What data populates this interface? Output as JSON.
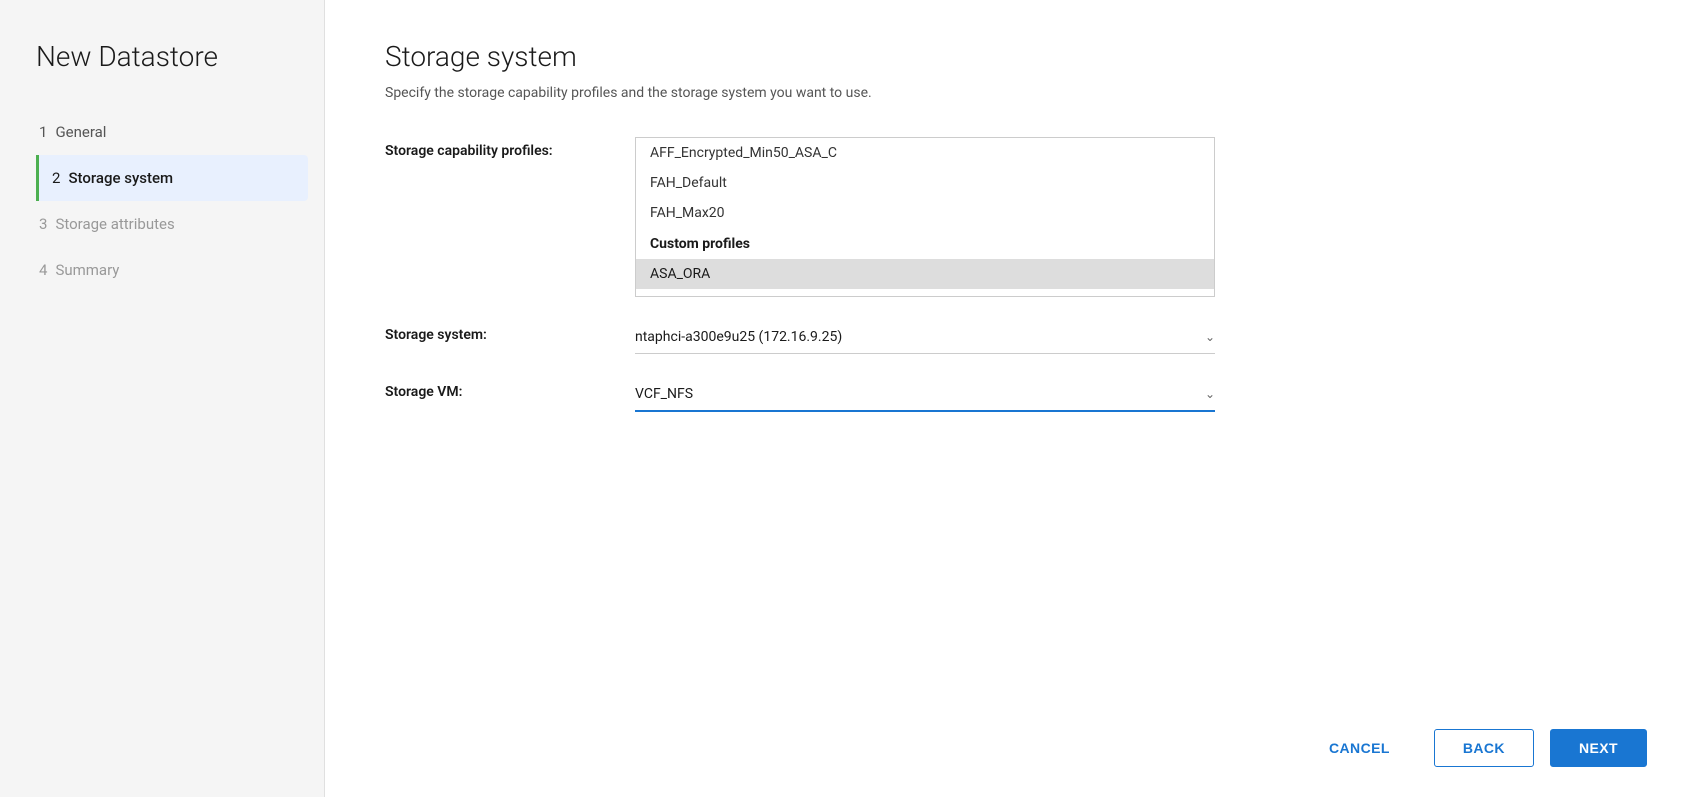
{
  "sidebar": {
    "title": "New Datastore",
    "steps": [
      {
        "id": "general",
        "number": "1",
        "label": "General",
        "state": "completed"
      },
      {
        "id": "storage-system",
        "number": "2",
        "label": "Storage system",
        "state": "active"
      },
      {
        "id": "storage-attributes",
        "number": "3",
        "label": "Storage attributes",
        "state": "inactive"
      },
      {
        "id": "summary",
        "number": "4",
        "label": "Summary",
        "state": "inactive"
      }
    ]
  },
  "main": {
    "title": "Storage system",
    "subtitle": "Specify the storage capability profiles and the storage system you want to use.",
    "fields": {
      "profiles_label": "Storage capability profiles:",
      "system_label": "Storage system:",
      "vm_label": "Storage VM:"
    },
    "profiles": [
      {
        "id": "aff",
        "label": "AFF_Encrypted_Min50_ASA_C",
        "type": "item"
      },
      {
        "id": "fah-default",
        "label": "FAH_Default",
        "type": "item"
      },
      {
        "id": "fah-max20",
        "label": "FAH_Max20",
        "type": "item"
      },
      {
        "id": "custom-header",
        "label": "Custom profiles",
        "type": "group-header"
      },
      {
        "id": "asa-ora",
        "label": "ASA_ORA",
        "type": "item",
        "selected": true
      }
    ],
    "storage_system": {
      "value": "ntaphci-a300e9u25 (172.16.9.25)",
      "options": [
        "ntaphci-a300e9u25 (172.16.9.25)"
      ]
    },
    "storage_vm": {
      "value": "VCF_NFS",
      "options": [
        "VCF_NFS"
      ]
    }
  },
  "footer": {
    "cancel_label": "CANCEL",
    "back_label": "BACK",
    "next_label": "NEXT"
  }
}
